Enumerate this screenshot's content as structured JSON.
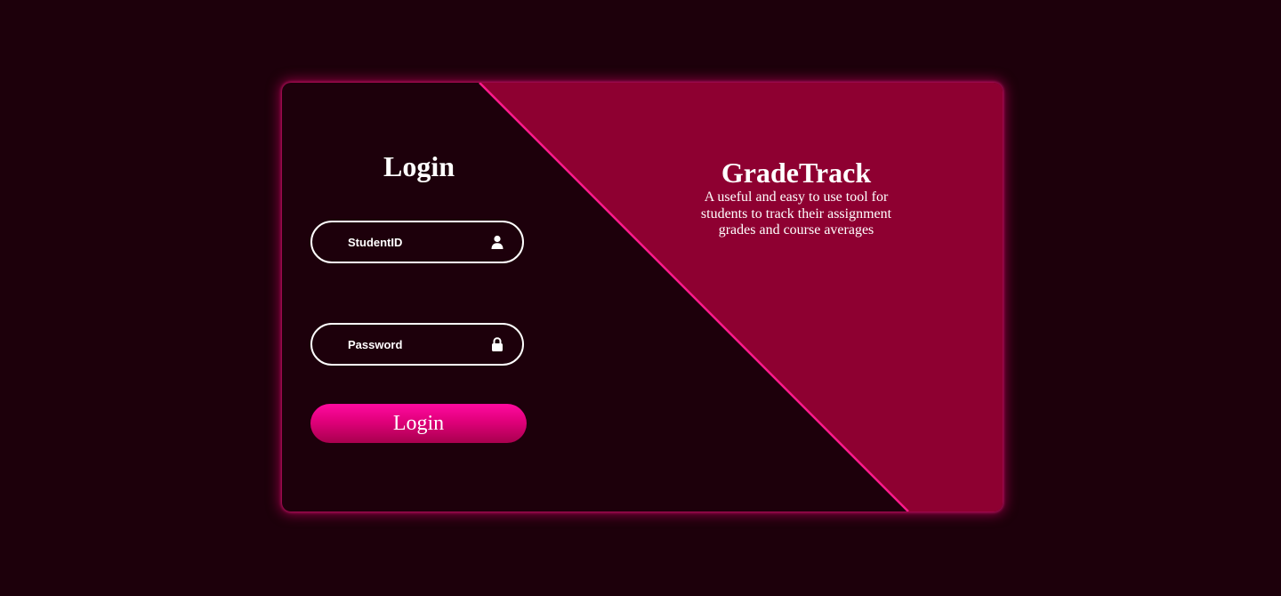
{
  "login": {
    "title": "Login",
    "student_id_placeholder": "StudentID",
    "password_placeholder": "Password",
    "button_label": "Login"
  },
  "brand": {
    "name": "GradeTrack",
    "description": "A useful and easy to use tool for students to track their assignment grades and course averages"
  },
  "icons": {
    "student_id": "user-icon",
    "password": "lock-icon"
  },
  "colors": {
    "background": "#1d000b",
    "accent_panel": "#8e0031",
    "accent_glow": "#ff1a8c",
    "button_gradient_top": "#ff0aa0",
    "button_gradient_bottom": "#a8004e",
    "text": "#ffffff"
  }
}
